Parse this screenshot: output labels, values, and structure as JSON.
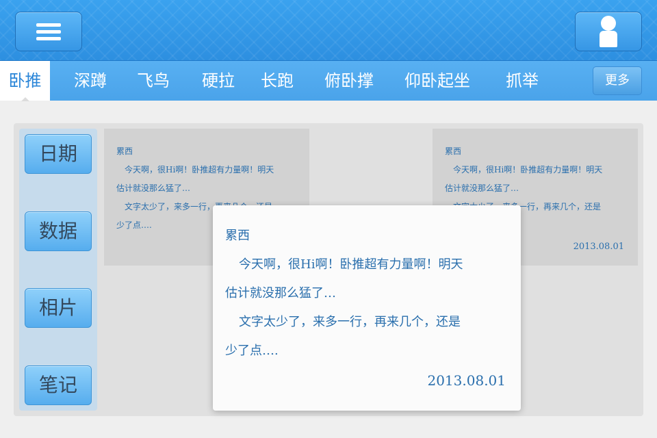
{
  "header": {
    "menu_icon": "hamburger-menu-icon",
    "user_icon": "user-icon",
    "colors": {
      "brand_blue": "#2d8fe0",
      "accent_text": "#2a6fad"
    }
  },
  "tabs": [
    {
      "label": "卧推",
      "active": true
    },
    {
      "label": "深蹲"
    },
    {
      "label": "飞鸟"
    },
    {
      "label": "硬拉"
    },
    {
      "label": "长跑"
    },
    {
      "label": "俯卧撑"
    },
    {
      "label": "仰卧起坐"
    },
    {
      "label": "抓举"
    }
  ],
  "more_label": "更多",
  "sidebar": {
    "items": [
      {
        "label": "日期"
      },
      {
        "label": "数据"
      },
      {
        "label": "相片"
      },
      {
        "label": "笔记"
      }
    ]
  },
  "notes": [
    {
      "title": "累西",
      "lines": [
        "今天啊，很Hi啊！卧推超有力量啊！明天",
        "估计就没那么猛了…",
        "文字太少了，来多一行，再来几个，还是",
        "少了点…."
      ],
      "date": ""
    },
    {
      "title": "累西",
      "lines": [
        "今天啊，很Hi啊！卧推超有力量啊！明天",
        "估计就没那么猛了…",
        "文字太少了，来多一行，再来几个，还是",
        ""
      ],
      "date": "2013.08.01"
    }
  ],
  "modal": {
    "title": "累西",
    "lines": [
      "今天啊，很Hi啊！卧推超有力量啊！明天",
      "估计就没那么猛了…",
      "文字太少了，来多一行，再来几个，还是",
      "少了点…."
    ],
    "date": "2013.08.01"
  }
}
